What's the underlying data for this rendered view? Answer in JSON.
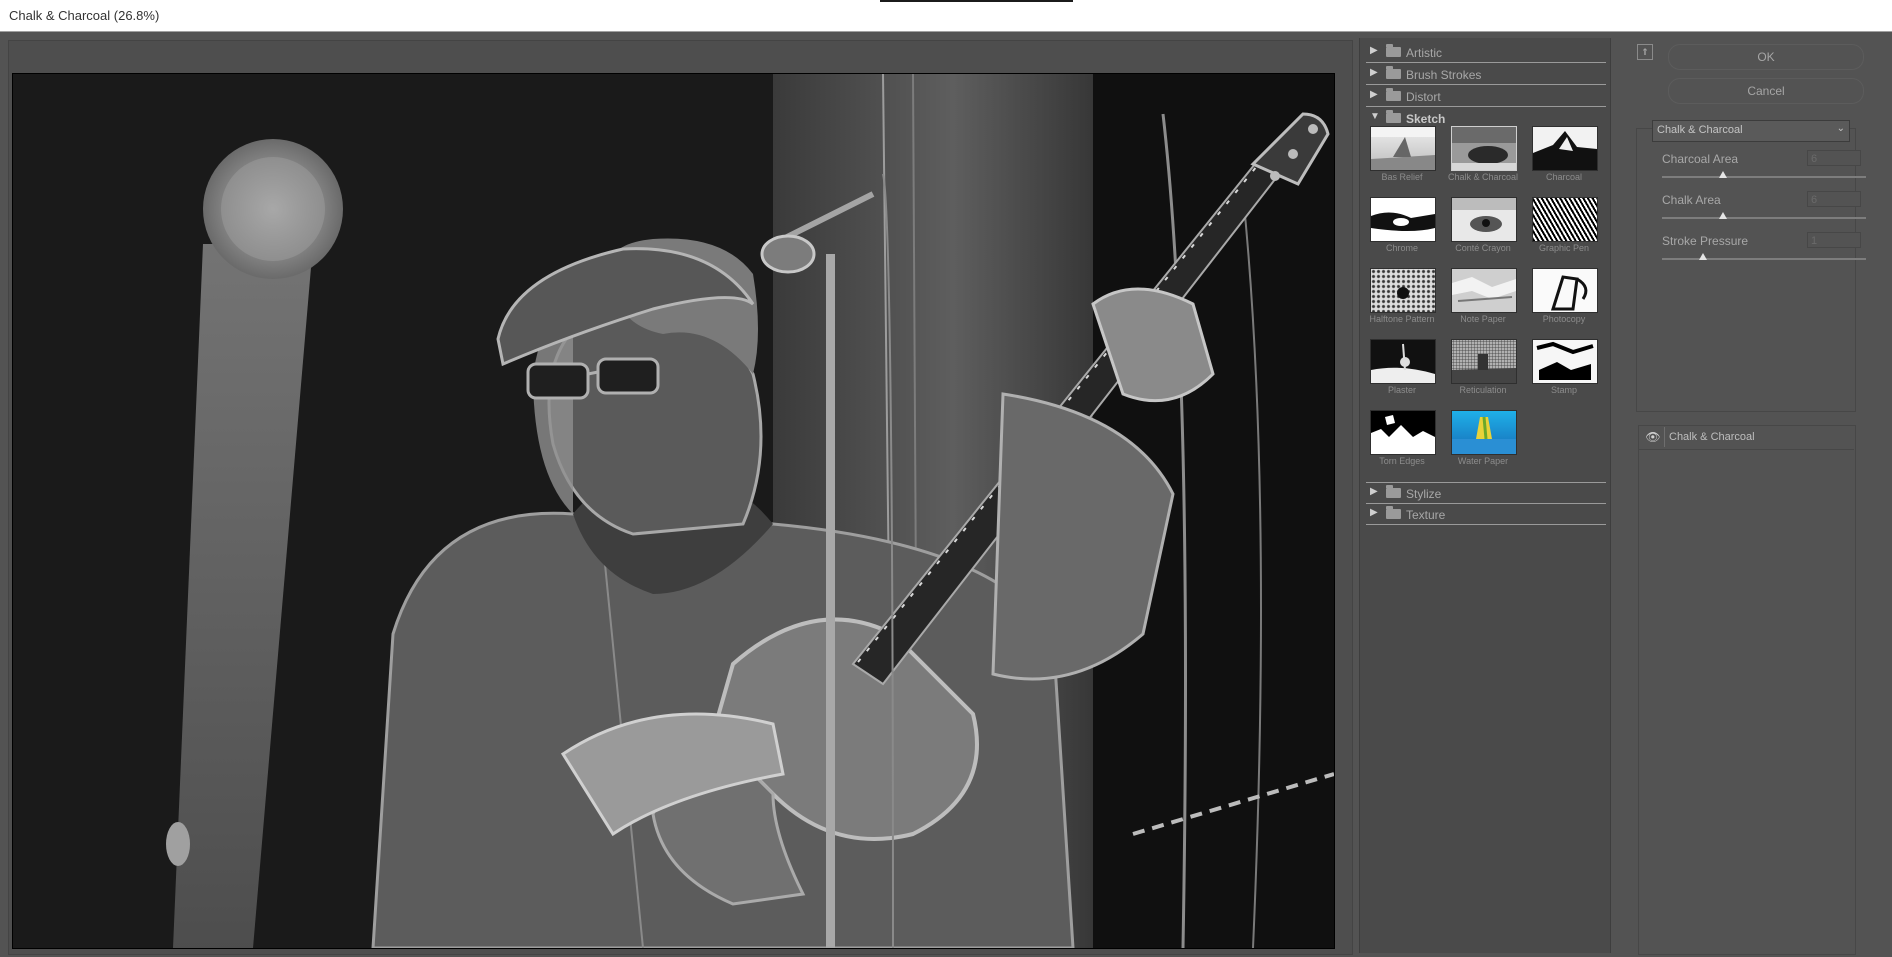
{
  "window": {
    "title": "Chalk & Charcoal (26.8%)"
  },
  "gallery": {
    "folders_top": [
      {
        "label": "Artistic",
        "open": false
      },
      {
        "label": "Brush Strokes",
        "open": false
      },
      {
        "label": "Distort",
        "open": false
      },
      {
        "label": "Sketch",
        "open": true
      }
    ],
    "sketch_filters": [
      {
        "label": "Bas Relief",
        "selected": false
      },
      {
        "label": "Chalk & Charcoal",
        "selected": true
      },
      {
        "label": "Charcoal",
        "selected": false
      },
      {
        "label": "Chrome",
        "selected": false
      },
      {
        "label": "Conté Crayon",
        "selected": false
      },
      {
        "label": "Graphic Pen",
        "selected": false
      },
      {
        "label": "Halftone Pattern",
        "selected": false
      },
      {
        "label": "Note Paper",
        "selected": false
      },
      {
        "label": "Photocopy",
        "selected": false
      },
      {
        "label": "Plaster",
        "selected": false
      },
      {
        "label": "Reticulation",
        "selected": false
      },
      {
        "label": "Stamp",
        "selected": false
      },
      {
        "label": "Torn Edges",
        "selected": false
      },
      {
        "label": "Water Paper",
        "selected": false
      }
    ],
    "folders_bottom": [
      {
        "label": "Stylize",
        "open": false
      },
      {
        "label": "Texture",
        "open": false
      }
    ]
  },
  "buttons": {
    "ok": "OK",
    "cancel": "Cancel"
  },
  "settings": {
    "filter_select": "Chalk & Charcoal",
    "params": [
      {
        "label": "Charcoal Area",
        "accel": "C",
        "value": "6",
        "fraction": 0.3
      },
      {
        "label": "Chalk Area",
        "accel": "h",
        "value": "6",
        "fraction": 0.3
      },
      {
        "label": "Stroke Pressure",
        "accel": "S",
        "value": "1",
        "fraction": 0.2
      }
    ]
  },
  "effect_layers": [
    {
      "name": "Chalk & Charcoal",
      "visible": true,
      "icon": "eye-icon"
    }
  ],
  "colors": {
    "panel": "#535353",
    "preview_bg": "#4e4e4e",
    "water_paper_blue": "#1e8fd8",
    "water_paper_yellow": "#e8d23a"
  }
}
